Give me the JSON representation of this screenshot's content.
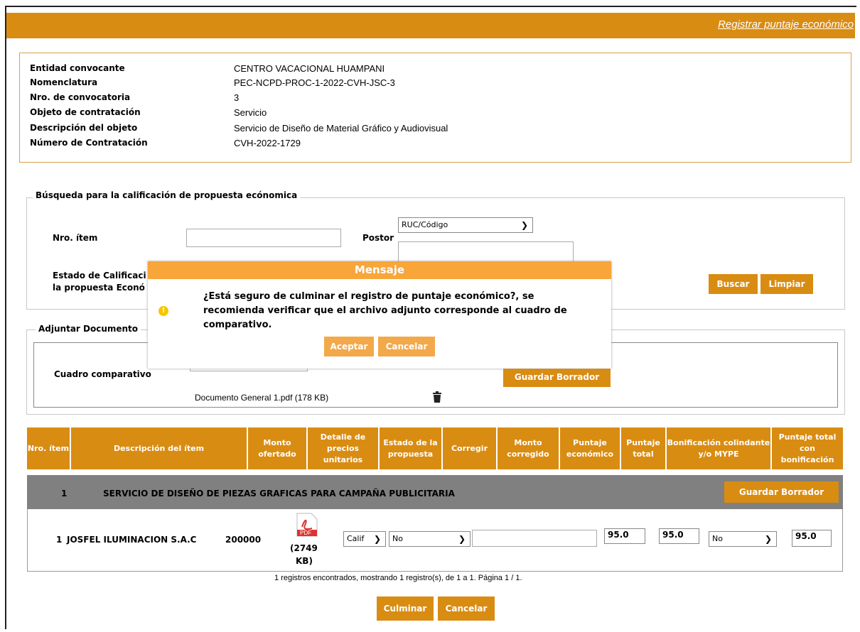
{
  "header": {
    "link": "Registrar puntaje económico"
  },
  "info": {
    "rows": [
      {
        "label": "Entidad convocante",
        "value": "CENTRO VACACIONAL HUAMPANI"
      },
      {
        "label": "Nomenclatura",
        "value": "PEC-NCPD-PROC-1-2022-CVH-JSC-3"
      },
      {
        "label": "Nro. de convocatoria",
        "value": "3"
      },
      {
        "label": "Objeto de contratación",
        "value": "Servicio"
      },
      {
        "label": "Descripción del objeto",
        "value": "Servicio de Diseño de Material Gráfico y Audiovisual"
      },
      {
        "label": "Número de Contratación",
        "value": "CVH-2022-1729"
      }
    ]
  },
  "search": {
    "legend": "Búsqueda para la calificación de propuesta ecónomica",
    "item_label": "Nro. ítem",
    "postor_label": "Postor",
    "postor_select": "RUC/Código",
    "estado_label_1": "Estado de Calificaci",
    "estado_label_2": "la propuesta Econó",
    "buscar": "Buscar",
    "limpiar": "Limpiar"
  },
  "attach": {
    "legend": "Adjuntar Documento",
    "label": "Cuadro comparativo",
    "save_draft": "Guardar Borrador",
    "file": "Documento General 1.pdf (178 KB)"
  },
  "table": {
    "headers": [
      "Nro. ítem",
      "Descripción del ítem",
      "Monto ofertado",
      "Detalle de precios unitarios",
      "Estado de la propuesta",
      "Corregir",
      "Monto corregido",
      "Puntaje económico",
      "Puntaje total",
      "Bonificación colindante y/o MYPE",
      "Puntaje total con bonificación"
    ],
    "group": {
      "num": "1",
      "desc": "SERVICIO DE DISEÑO DE PIEZAS GRAFICAS PARA CAMPAÑA PUBLICITARIA",
      "button": "Guardar Borrador"
    },
    "row": {
      "num": "1",
      "postor": "JOSFEL ILUMINACION S.A.C",
      "monto": "200000",
      "pdf_label": "PDF",
      "pdf_size_1": "(2749",
      "pdf_size_2": "KB)",
      "estado": "Calif",
      "corregir": "No",
      "puntaje_economico": "95.0",
      "puntaje_total": "95.0",
      "bonificacion": "No",
      "puntaje_bonif": "95.0"
    },
    "footer": "1 registros encontrados, mostrando 1 registro(s), de 1 a 1. Página 1 / 1."
  },
  "actions": {
    "culminar": "Culminar",
    "cancelar": "Cancelar"
  },
  "dialog": {
    "title": "Mensaje",
    "line1": "¿Está seguro de culminar el registro de puntaje económico?, se",
    "line2": "recomienda verificar que el archivo adjunto corresponde al cuadro de",
    "line3": "comparativo.",
    "accept": "Aceptar",
    "cancel": "Cancelar"
  },
  "colors": {
    "accent": "#d98c12",
    "dialog_title": "#f8a53a",
    "gray_row": "#808080"
  },
  "icons": [
    "trash-icon",
    "pdf-icon",
    "warning-icon",
    "chevron-down-icon"
  ]
}
